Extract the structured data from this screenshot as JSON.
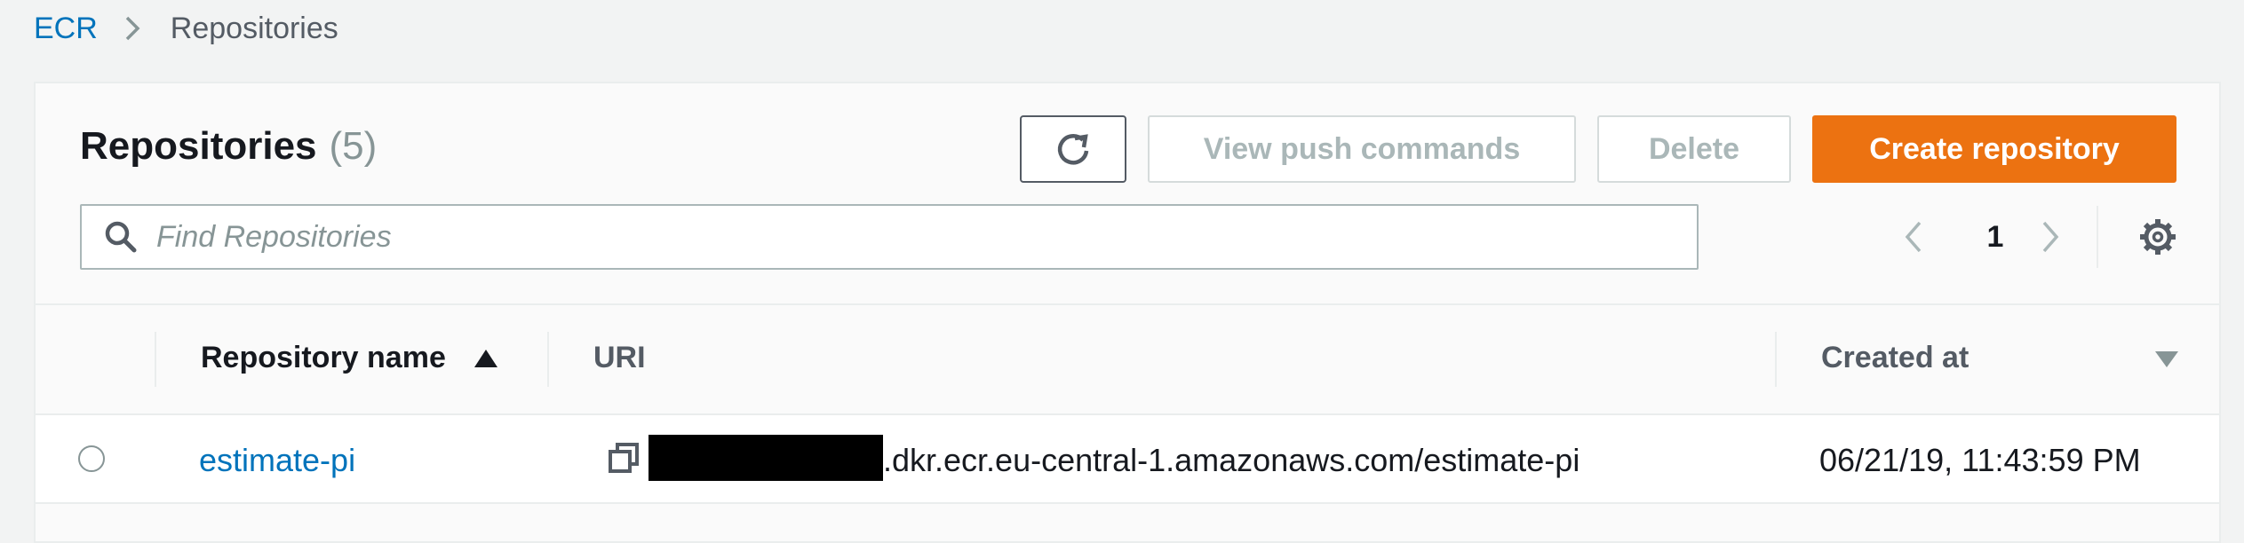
{
  "breadcrumb": {
    "root": "ECR",
    "current": "Repositories"
  },
  "header": {
    "title": "Repositories",
    "count": "(5)"
  },
  "toolbar": {
    "refresh_icon": "refresh-icon",
    "view_push_label": "View push commands",
    "delete_label": "Delete",
    "create_label": "Create repository"
  },
  "search": {
    "placeholder": "Find Repositories",
    "value": ""
  },
  "pagination": {
    "current_page": "1"
  },
  "table": {
    "columns": [
      "Repository name",
      "URI",
      "Created at"
    ],
    "sort_column": "Repository name",
    "sort_direction": "ascending",
    "rows": [
      {
        "name": "estimate-pi",
        "uri_suffix": ".dkr.ecr.eu-central-1.amazonaws.com/estimate-pi",
        "created": "06/21/19, 11:43:59 PM"
      }
    ]
  },
  "colors": {
    "link": "#0073bb",
    "primary": "#ec7211",
    "disabled": "#aab7b8",
    "background": "#f2f3f3"
  }
}
